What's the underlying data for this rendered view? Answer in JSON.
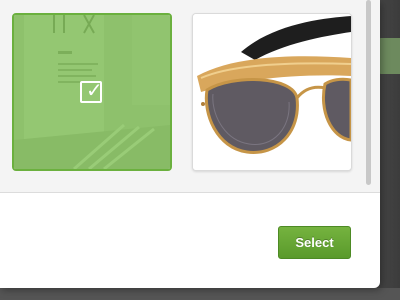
{
  "picker": {
    "images": [
      {
        "name": "building-photo",
        "selected": true
      },
      {
        "name": "sunglasses-photo",
        "selected": false
      }
    ],
    "select_label": "Select"
  },
  "colors": {
    "selection_overlay": "#6bb03e",
    "select_button": "#64a533"
  },
  "icons": {
    "selected_indicator": "checkbox-checked-icon"
  }
}
